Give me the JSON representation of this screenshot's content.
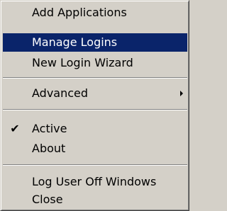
{
  "menu": {
    "items": [
      {
        "label": "Add Applications"
      },
      {
        "label": "Manage Logins"
      },
      {
        "label": "New Login Wizard"
      },
      {
        "label": "Advanced"
      },
      {
        "label": "Active",
        "check": "✔"
      },
      {
        "label": "About"
      },
      {
        "label": "Log User Off Windows"
      },
      {
        "label": "Close"
      }
    ]
  },
  "colors": {
    "menu_background": "#d4d0c8",
    "highlight_background": "#0a246a",
    "highlight_text": "#ffffff"
  }
}
